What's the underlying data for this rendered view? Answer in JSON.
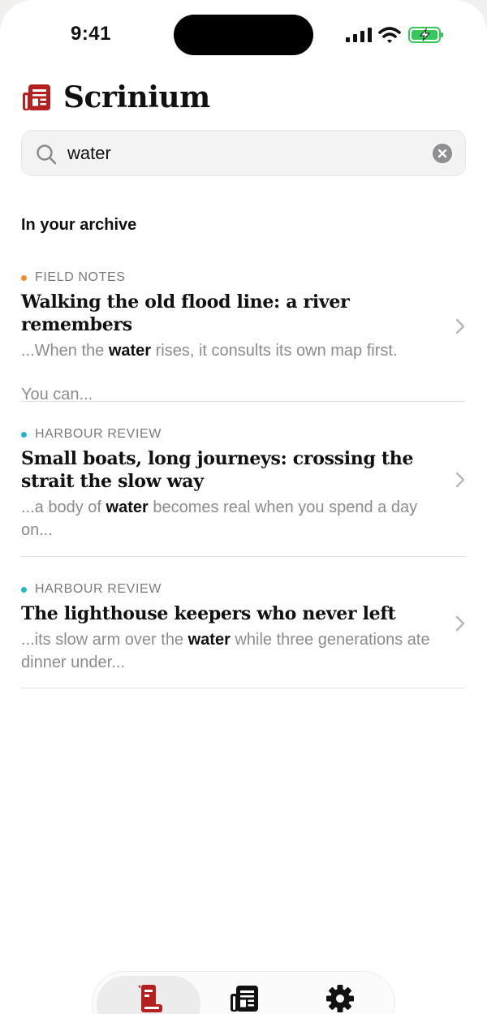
{
  "status_bar": {
    "time": "9:41"
  },
  "app": {
    "title": "Scrinium",
    "accent_color": "#b3201f"
  },
  "search": {
    "value": "water",
    "placeholder": "Search"
  },
  "section": {
    "title": "In your archive"
  },
  "results": [
    {
      "source": "FIELD NOTES",
      "dot_color": "#f28b2a",
      "title": "Walking the old flood line: a river remembers",
      "snippet_before": "...When the ",
      "snippet_match": "water",
      "snippet_after": " rises, it consults its own map first.",
      "snippet_extra": "You can..."
    },
    {
      "source": "HARBOUR REVIEW",
      "dot_color": "#1fb6c9",
      "title": "Small boats, long journeys: crossing the strait the slow way",
      "snippet_before": "...a body of ",
      "snippet_match": "water",
      "snippet_after": " becomes real when you spend a day on...",
      "snippet_extra": ""
    },
    {
      "source": "HARBOUR REVIEW",
      "dot_color": "#1fb6c9",
      "title": "The lighthouse keepers who never left",
      "snippet_before": "...its slow arm over the ",
      "snippet_match": "water",
      "snippet_after": " while three generations ate dinner under...",
      "snippet_extra": ""
    }
  ],
  "tabbar": {
    "tabs": [
      {
        "icon": "scroll-icon",
        "active": true
      },
      {
        "icon": "newspaper-icon",
        "active": false
      },
      {
        "icon": "gear-icon",
        "active": false
      }
    ]
  }
}
